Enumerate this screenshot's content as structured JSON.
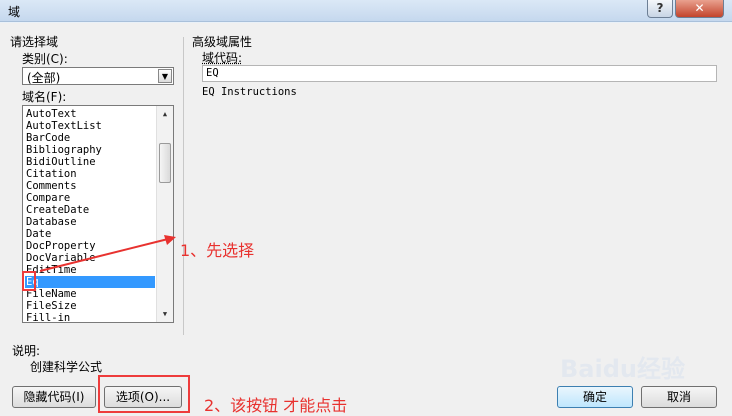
{
  "window": {
    "title": "域",
    "help": "?",
    "close": "✕"
  },
  "left": {
    "group_title": "请选择域",
    "category_label": "类别(C):",
    "category_value": "(全部)",
    "fieldname_label": "域名(F):",
    "items": [
      "AutoText",
      "AutoTextList",
      "BarCode",
      "Bibliography",
      "BidiOutline",
      "Citation",
      "Comments",
      "Compare",
      "CreateDate",
      "Database",
      "Date",
      "DocProperty",
      "DocVariable",
      "EditTime",
      "Eq",
      "FileName",
      "FileSize",
      "Fill-in"
    ],
    "selected_index": 14
  },
  "right": {
    "group_title": "高级域属性",
    "code_label": "域代码:",
    "code_value": "EQ",
    "instructions": "EQ Instructions"
  },
  "description": {
    "label": "说明:",
    "text": "创建科学公式"
  },
  "buttons": {
    "hide_codes": "隐藏代码(I)",
    "options": "选项(O)...",
    "ok": "确定",
    "cancel": "取消"
  },
  "annotations": {
    "step1": "1、先选择",
    "step2": "2、该按钮 才能点击"
  },
  "watermark": "Baidu经验",
  "colors": {
    "selection": "#3399ff",
    "annotation": "#e8322f"
  }
}
